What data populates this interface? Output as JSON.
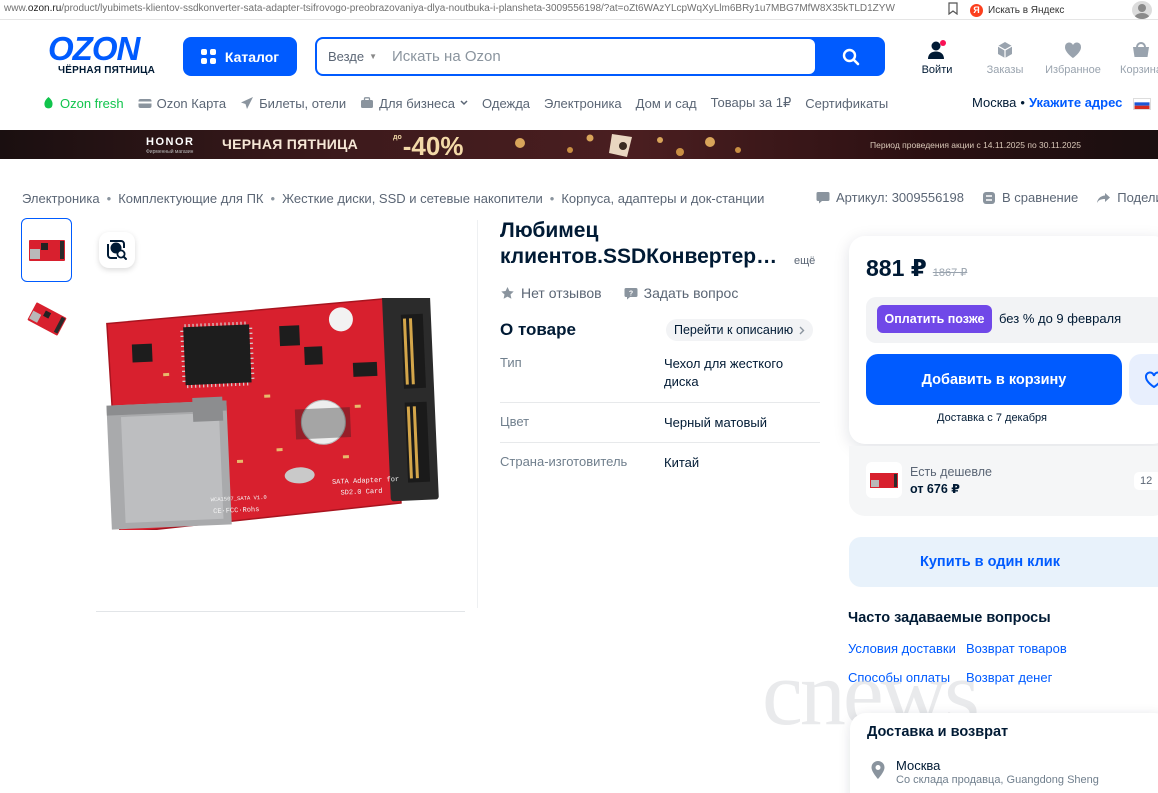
{
  "browser": {
    "url_prefix": "www.",
    "url_domain": "ozon.ru",
    "url_rest": "/product/lyubimets-klientov-ssdkonverter-sata-adapter-tsifrovogo-preobrazovaniya-dlya-noutbuka-i-plansheta-3009556198/?at=oZt6WAzYLcpWqXyLlm6BRy1u7MBG7MfW8X35kTLD1ZYW",
    "yandex_label": "Искать в Яндекс"
  },
  "header": {
    "logo_text": "OZON",
    "logo_sub": "ЧЁРНАЯ ПЯТНИЦА",
    "catalog_label": "Каталог",
    "search_scope": "Везде",
    "search_placeholder": "Искать на Ozon",
    "actions": [
      {
        "label": "Войти",
        "icon": "user-icon"
      },
      {
        "label": "Заказы",
        "icon": "box-icon"
      },
      {
        "label": "Избранное",
        "icon": "heart-icon"
      },
      {
        "label": "Корзина",
        "icon": "cart-icon"
      }
    ]
  },
  "nav": {
    "items": [
      "Ozon fresh",
      "Ozon Карта",
      "Билеты, отели",
      "Для бизнеса",
      "Одежда",
      "Электроника",
      "Дом и сад",
      "Товары за 1₽",
      "Сертификаты"
    ],
    "city": "Москва",
    "dot": "•",
    "address_link": "Укажите адрес"
  },
  "banner": {
    "brand": "HONOR",
    "brand_sub": "Фирменный магазин",
    "title": "ЧЕРНАЯ ПЯТНИЦА",
    "pct_prefix": "до",
    "pct": "-40%",
    "period": "Период проведения акции с 14.11.2025 по 30.11.2025"
  },
  "breadcrumbs": [
    "Электроника",
    "Комплектующие для ПК",
    "Жесткие диски, SSD и сетевые накопители",
    "Корпуса, адаптеры и док-станции"
  ],
  "meta": {
    "article": "Артикул: 3009556198",
    "compare": "В сравнение",
    "share": "Подели"
  },
  "product": {
    "title_line1": "Любимец",
    "title_line2": "клиентов.SSDКонвертер SATA",
    "more": "ещё",
    "reviews": "Нет отзывов",
    "ask": "Задать вопрос",
    "about_title": "О товаре",
    "goto_desc": "Перейти к описанию",
    "specs": [
      {
        "k": "Тип",
        "v": "Чехол для жесткого диска"
      },
      {
        "k": "Цвет",
        "v": "Черный матовый"
      },
      {
        "k": "Страна-изготовитель",
        "v": "Китай"
      }
    ],
    "board_labels": [
      "SATA Adapter for",
      "SD2.0 Card",
      "CE·FCC·Rohs",
      "WCA1507_SATA V1.0"
    ]
  },
  "buy": {
    "price": "881 ₽",
    "old_price": "1867 ₽",
    "pay_later_btn": "Оплатить позже",
    "pay_later_text": "без % до 9 февраля",
    "add_to_cart": "Добавить в корзину",
    "delivery": "Доставка с 7 декабря",
    "cheaper_title": "Есть дешевле",
    "cheaper_price": "от 676 ₽",
    "cheaper_count": "12",
    "one_click": "Купить в один клик"
  },
  "faq": {
    "title": "Часто задаваемые вопросы",
    "links": [
      "Условия доставки",
      "Возврат товаров",
      "Способы оплаты",
      "Возврат денег"
    ]
  },
  "delivery_card": {
    "title": "Доставка и возврат",
    "city": "Москва",
    "from": "Со склада продавца, Guangdong Sheng"
  },
  "watermark": "cnews",
  "colors": {
    "brand": "#005bff",
    "pay_later": "#7048e8",
    "board_red": "#d8202e"
  }
}
